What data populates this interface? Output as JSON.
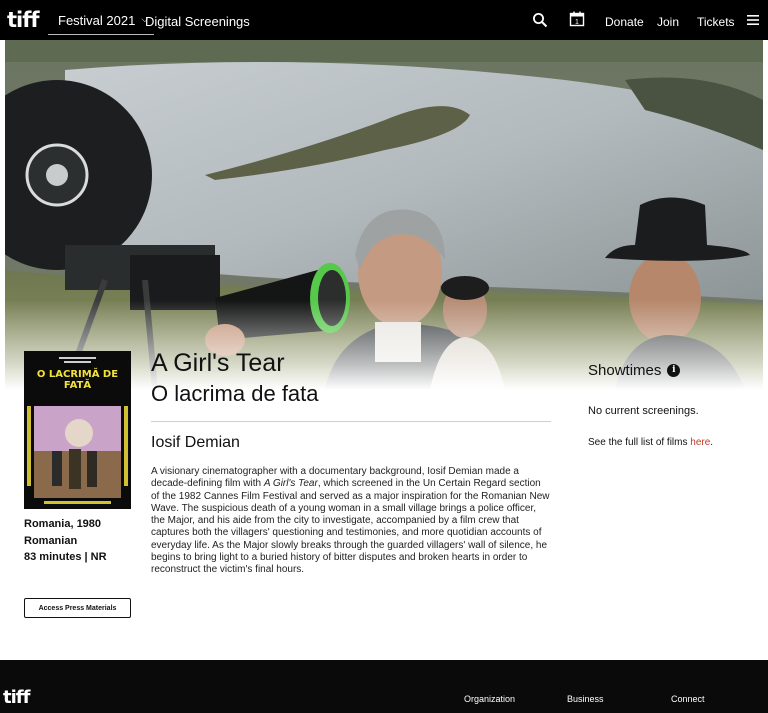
{
  "header": {
    "logo": "tiff",
    "festival_select": "Festival 2021",
    "digital_link": "Digital Screenings",
    "nav": [
      "Donate",
      "Join",
      "Tickets"
    ],
    "calendar_day": "1",
    "icons": [
      "search-icon",
      "calendar-icon",
      "menu-icon"
    ],
    "background_color": "#000000"
  },
  "film": {
    "title": "A Girl's Tear",
    "original_title": "O lacrima de fata",
    "director": "Iosif Demian",
    "country_year": "Romania, 1980",
    "language": "Romanian",
    "runtime_rating": "83 minutes | NR",
    "press_button": "Access Press Materials",
    "synopsis_part1": "A visionary cinematographer with a documentary background, Iosif Demian made a decade-defining film with ",
    "synopsis_italic": "A Girl's Tear",
    "synopsis_part2": ", which screened in the Un Certain Regard section of the 1982 Cannes Film Festival and served as a major inspiration for the Romanian New Wave. The suspicious death of a young woman in a small village brings a police officer, the Major, and his aide from the city to investigate, accompanied by a film crew that captures both the villagers' questioning and testimonies, and more quotidian accounts of everyday life. As the Major slowly breaks through the guarded villagers' wall of silence, he begins to bring light to a buried history of bitter disputes and broken hearts in order to reconstruct the victim's final hours."
  },
  "poster": {
    "title_text": "O LACRIMĂ DE FATĂ",
    "accent_color": "#f2e23a"
  },
  "showtimes": {
    "heading": "Showtimes",
    "no_screenings": "No current screenings.",
    "full_list_prefix": "See the full list of films ",
    "full_list_link": "here",
    "full_list_suffix": ".",
    "link_color": "#c0392b"
  },
  "footer": {
    "logo": "tiff",
    "columns": [
      "Organization",
      "Business",
      "Connect"
    ]
  }
}
